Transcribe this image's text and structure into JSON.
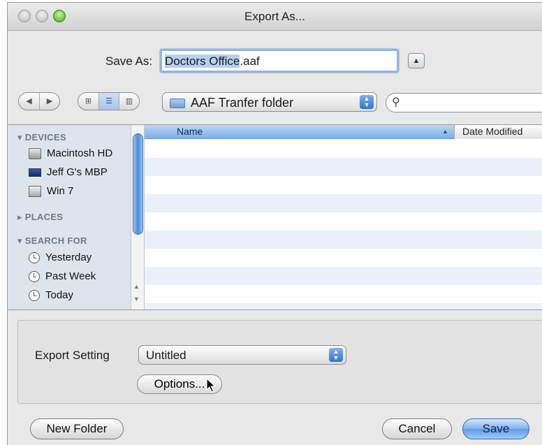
{
  "window": {
    "title": "Export As..."
  },
  "save_as": {
    "label": "Save As:",
    "filename_selected": "Doctors Office",
    "filename_ext": ".aaf"
  },
  "toolbar": {
    "location": "AAF Tranfer folder",
    "search_placeholder": ""
  },
  "sidebar": {
    "devices_header": "DEVICES",
    "devices": [
      "Macintosh HD",
      "Jeff G's MBP",
      "Win 7"
    ],
    "places_header": "PLACES",
    "search_header": "SEARCH FOR",
    "searches": [
      "Yesterday",
      "Past Week",
      "Today"
    ]
  },
  "file_list": {
    "columns": {
      "name": "Name",
      "date": "Date Modified"
    },
    "rows": []
  },
  "export": {
    "label": "Export Setting",
    "selected": "Untitled",
    "options_label": "Options..."
  },
  "buttons": {
    "new_folder": "New Folder",
    "cancel": "Cancel",
    "save": "Save"
  },
  "colors": {
    "accent": "#5f9be6",
    "sidebar_bg": "#dde4ec",
    "row_alt": "#ebf1fa"
  }
}
